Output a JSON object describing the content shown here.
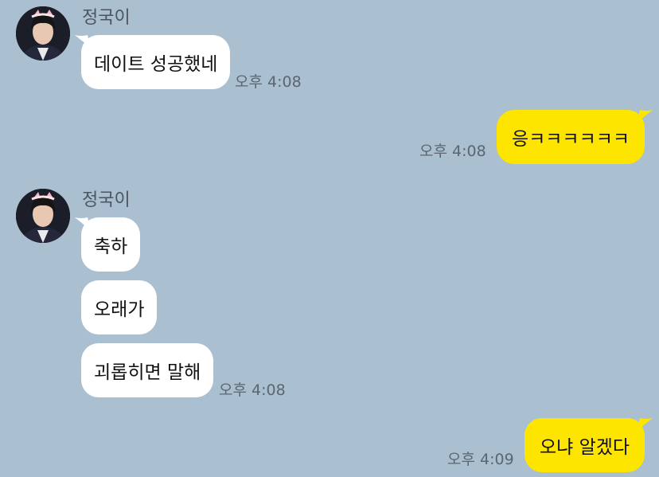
{
  "colors": {
    "background": "#aabfd0",
    "incoming_bubble": "#ffffff",
    "outgoing_bubble": "#fee500",
    "timestamp": "#5b6670",
    "sender_name": "#4a5560"
  },
  "messages": [
    {
      "direction": "incoming",
      "sender": "정국이",
      "avatar_icon": "profile-photo",
      "bubbles": [
        "데이트 성공했네"
      ],
      "time": "오후 4:08"
    },
    {
      "direction": "outgoing",
      "bubbles": [
        "응ㅋㅋㅋㅋㅋㅋ"
      ],
      "time": "오후 4:08"
    },
    {
      "direction": "incoming",
      "sender": "정국이",
      "avatar_icon": "profile-photo",
      "bubbles": [
        "축하",
        "오래가",
        "괴롭히면 말해"
      ],
      "time": "오후 4:08"
    },
    {
      "direction": "outgoing",
      "bubbles": [
        "오냐 알겠다"
      ],
      "time": "오후 4:09"
    }
  ]
}
